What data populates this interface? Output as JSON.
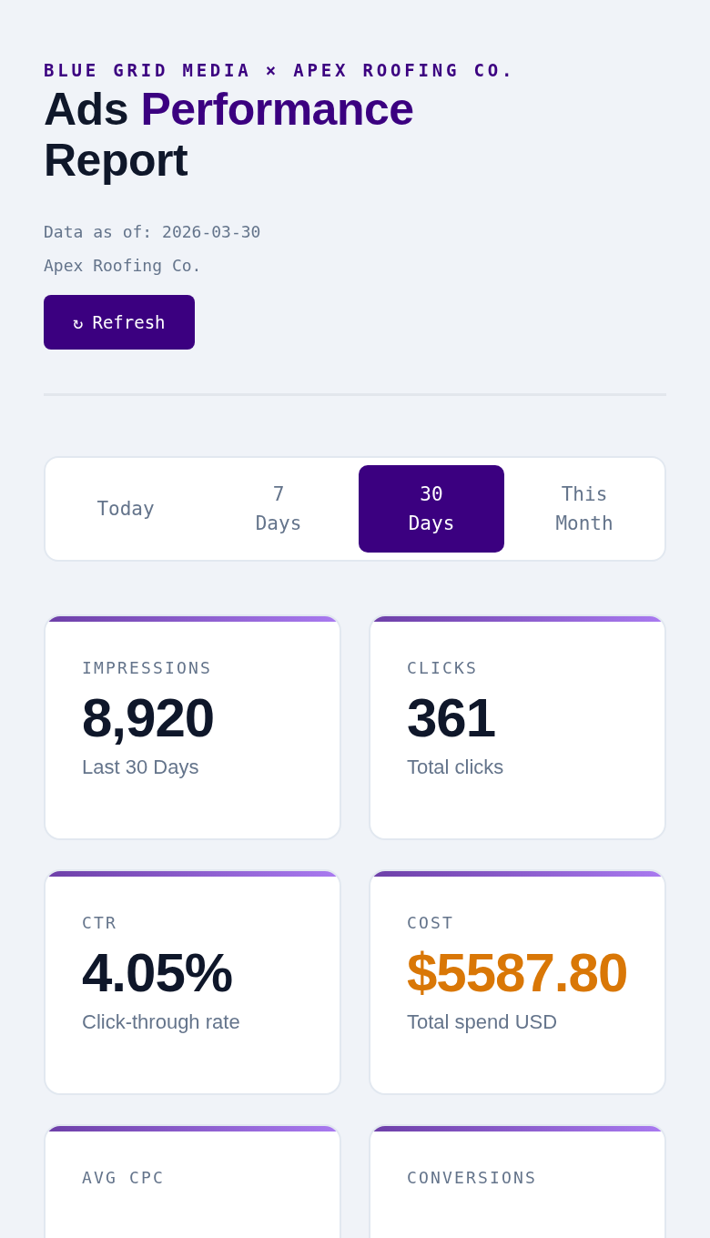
{
  "header": {
    "eyebrow": "BLUE GRID MEDIA × APEX ROOFING CO.",
    "title_start": "Ads",
    "title_accent": "Performance",
    "title_end": "Report",
    "data_as_of": "Data as of: 2026-03-30",
    "client": "Apex Roofing Co.",
    "refresh_button": {
      "icon": "↻",
      "label": "Refresh"
    }
  },
  "range_tabs": [
    {
      "label": "Today",
      "selected": false
    },
    {
      "label": "7 Days",
      "selected": false
    },
    {
      "label": "30 Days",
      "selected": true
    },
    {
      "label": "This Month",
      "selected": false
    }
  ],
  "metrics": [
    {
      "label": "IMPRESSIONS",
      "value": "8,920",
      "color": "#0f172a",
      "caption": "Last 30 Days"
    },
    {
      "label": "CLICKS",
      "value": "361",
      "color": "#0f172a",
      "caption": "Total clicks"
    },
    {
      "label": "CTR",
      "value": "4.05%",
      "color": "#0f172a",
      "caption": "Click-through rate"
    },
    {
      "label": "COST",
      "value": "$5587.80",
      "color": "#d97706",
      "caption": "Total spend USD"
    },
    {
      "label": "AVG CPC"
    },
    {
      "label": "CONVERSIONS"
    }
  ]
}
